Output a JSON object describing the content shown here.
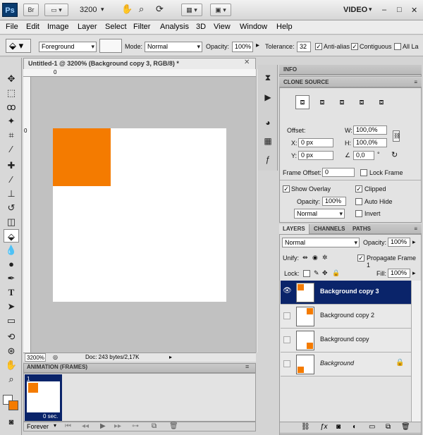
{
  "app": {
    "logo": "Ps",
    "bridge": "Br",
    "zoom": "3200",
    "workspace": "VIDEO",
    "window_min": "–",
    "window_max": "□",
    "window_close": "✕"
  },
  "menu": [
    "File",
    "Edit",
    "Image",
    "Layer",
    "Select",
    "Filter",
    "Analysis",
    "3D",
    "View",
    "Window",
    "Help"
  ],
  "options": {
    "fill_source": "Foreground",
    "mode_label": "Mode:",
    "mode_value": "Normal",
    "opacity_label": "Opacity:",
    "opacity_value": "100%",
    "tolerance_label": "Tolerance:",
    "tolerance_value": "32",
    "antialias": "Anti-alias",
    "contiguous": "Contiguous",
    "all_layers": "All La"
  },
  "document": {
    "tab_title": "Untitled-1 @ 3200% (Background copy 3, RGB/8) *",
    "ruler_h_zero": "0",
    "ruler_v_zero": "0",
    "zoom_field": "3200%",
    "doc_info": "Doc: 243 bytes/2,17K"
  },
  "info_panel": {
    "title": "INFO"
  },
  "clone_source": {
    "title": "CLONE SOURCE",
    "offset_label": "Offset:",
    "w_label": "W:",
    "w_value": "100,0%",
    "x_label": "X:",
    "x_value": "0 px",
    "h_label": "H:",
    "h_value": "100,0%",
    "y_label": "Y:",
    "y_value": "0 px",
    "angle_value": "0,0",
    "degree": "°",
    "frame_offset_label": "Frame Offset:",
    "frame_offset_value": "0",
    "lock_frame": "Lock Frame",
    "show_overlay": "Show Overlay",
    "clipped": "Clipped",
    "opacity_label": "Opacity:",
    "opacity_value": "100%",
    "auto_hide": "Auto Hide",
    "blend_mode": "Normal",
    "invert": "Invert"
  },
  "layers_panel": {
    "tabs": [
      "LAYERS",
      "CHANNELS",
      "PATHS"
    ],
    "blend_mode": "Normal",
    "opacity_label": "Opacity:",
    "opacity_value": "100%",
    "unify_label": "Unify:",
    "propagate": "Propagate Frame 1",
    "lock_label": "Lock:",
    "fill_label": "Fill:",
    "fill_value": "100%",
    "layers": [
      {
        "name": "Background copy 3"
      },
      {
        "name": "Background copy 2"
      },
      {
        "name": "Background copy"
      },
      {
        "name": "Background"
      }
    ]
  },
  "animation": {
    "title": "ANIMATION (FRAMES)",
    "frame_number": "1",
    "frame_time": "0 sec.",
    "loop": "Forever"
  },
  "colors": {
    "orange": "#f47b00",
    "selection": "#0a246a"
  }
}
